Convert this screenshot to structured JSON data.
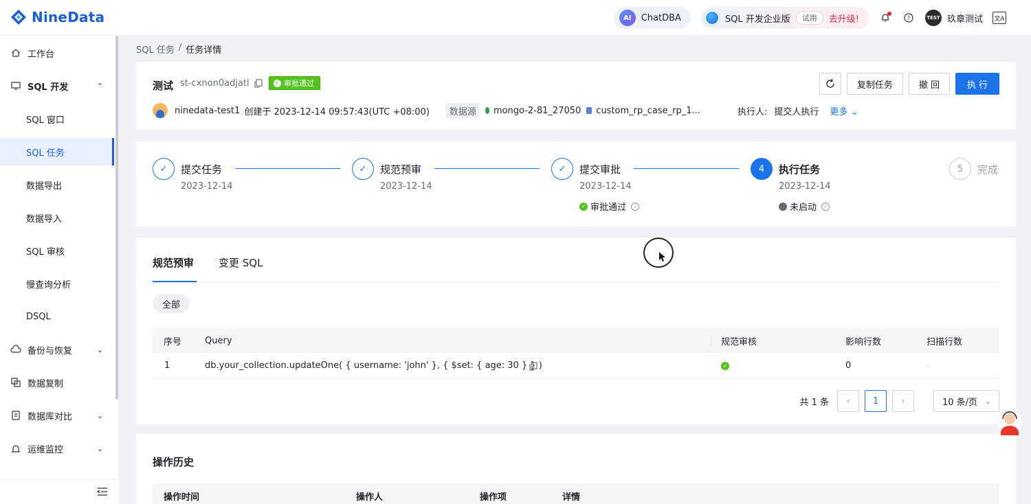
{
  "brand": {
    "name": "NineData"
  },
  "topbar": {
    "chatdba": "ChatDBA",
    "ai_label": "AI",
    "edition": "SQL 开发企业版",
    "trial": "试用",
    "upgrade": "去升级!",
    "user_badge": "TEST",
    "user": "玖章测试",
    "lang_glyph": "文A"
  },
  "sidebar": {
    "items": [
      {
        "label": "工作台"
      },
      {
        "label": "SQL 开发"
      },
      {
        "label": "SQL 窗口"
      },
      {
        "label": "SQL 任务"
      },
      {
        "label": "数据导出"
      },
      {
        "label": "数据导入"
      },
      {
        "label": "SQL 审核"
      },
      {
        "label": "慢查询分析"
      },
      {
        "label": "DSQL"
      },
      {
        "label": "备份与恢复"
      },
      {
        "label": "数据复制"
      },
      {
        "label": "数据库对比"
      },
      {
        "label": "运维监控"
      }
    ]
  },
  "breadcrumb": {
    "parent": "SQL 任务",
    "sep": "/",
    "current": "任务详情"
  },
  "task": {
    "name": "测试",
    "id": "st-cxnon0adjatl",
    "status": "审批通过",
    "creator": "ninedata-test1",
    "created_text": "创建于 2023-12-14 09:57:43(UTC +08:00)",
    "datasource_label": "数据源",
    "datasource": "mongo-2-81_27050",
    "database": "custom_rp_case_rp_1...",
    "executor_label": "执行人:",
    "executor": "提交人执行",
    "more": "更多",
    "buttons": {
      "copy": "复制任务",
      "revoke": "撤 回",
      "execute": "执 行"
    }
  },
  "steps": [
    {
      "num": "1",
      "title": "提交任务",
      "date": "2023-12-14",
      "status": ""
    },
    {
      "num": "2",
      "title": "规范预审",
      "date": "2023-12-14",
      "status": ""
    },
    {
      "num": "3",
      "title": "提交审批",
      "date": "2023-12-14",
      "status": "审批通过"
    },
    {
      "num": "4",
      "title": "执行任务",
      "date": "2023-12-14",
      "status": "未启动"
    },
    {
      "num": "5",
      "title": "完成",
      "date": "",
      "status": ""
    }
  ],
  "tabs": {
    "review": "规范预审",
    "sql": "变更 SQL"
  },
  "filter": {
    "all": "全部"
  },
  "table": {
    "columns": {
      "index": "序号",
      "query": "Query",
      "check": "规范审核",
      "affected": "影响行数",
      "scanned": "扫描行数"
    },
    "rows": [
      {
        "index": "1",
        "query": "db.your_collection.updateOne( { username: 'john' }, { $set: { age: 30 } } )",
        "affected": "0",
        "scanned": "-"
      }
    ]
  },
  "pagination": {
    "total": "共 1 条",
    "current": "1",
    "size": "10 条/页"
  },
  "history": {
    "title": "操作历史",
    "columns": {
      "time": "操作时间",
      "operator": "操作人",
      "action": "操作项",
      "detail": "详情"
    }
  },
  "colors": {
    "primary": "#1a73e8",
    "success": "#52c41a",
    "brand": "#1a5fd6",
    "accent": "#e0284e"
  }
}
